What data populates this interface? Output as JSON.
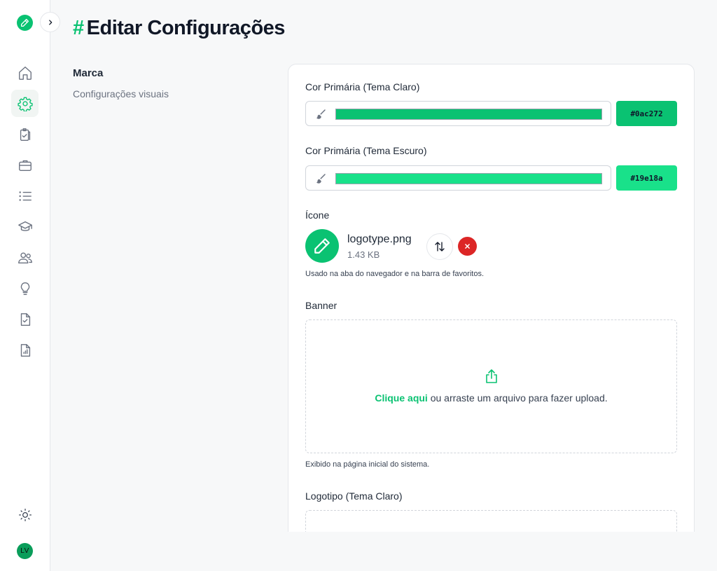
{
  "page": {
    "hash": "#",
    "title": "Editar Configurações"
  },
  "sidebar": {
    "items": [
      {
        "icon": "home-icon"
      },
      {
        "icon": "gear-icon",
        "active": true
      },
      {
        "icon": "clipboard-check-icon"
      },
      {
        "icon": "briefcase-icon"
      },
      {
        "icon": "list-icon"
      },
      {
        "icon": "graduation-cap-icon"
      },
      {
        "icon": "users-icon"
      },
      {
        "icon": "lightbulb-icon"
      },
      {
        "icon": "file-check-icon"
      },
      {
        "icon": "file-chart-icon"
      }
    ],
    "theme_icon": "sun-icon",
    "avatar_initials": "LV"
  },
  "section": {
    "title": "Marca",
    "subtitle": "Configurações visuais"
  },
  "form": {
    "primary_light": {
      "label": "Cor Primária (Tema Claro)",
      "value": "#0ac272"
    },
    "primary_dark": {
      "label": "Cor Primária (Tema Escuro)",
      "value": "#19e18a"
    },
    "icon": {
      "label": "Ícone",
      "file_name": "logotype.png",
      "file_size": "1.43 KB",
      "help": "Usado na aba do navegador e na barra de favoritos."
    },
    "banner": {
      "label": "Banner",
      "link_text": "Clique aqui",
      "rest_text": " ou arraste um arquivo para fazer upload.",
      "help": "Exibido na página inicial do sistema."
    },
    "logo_light": {
      "label": "Logotipo (Tema Claro)"
    }
  },
  "colors": {
    "accent": "#0ac272",
    "accent_dark_theme": "#19e18a",
    "danger": "#dc2626"
  }
}
